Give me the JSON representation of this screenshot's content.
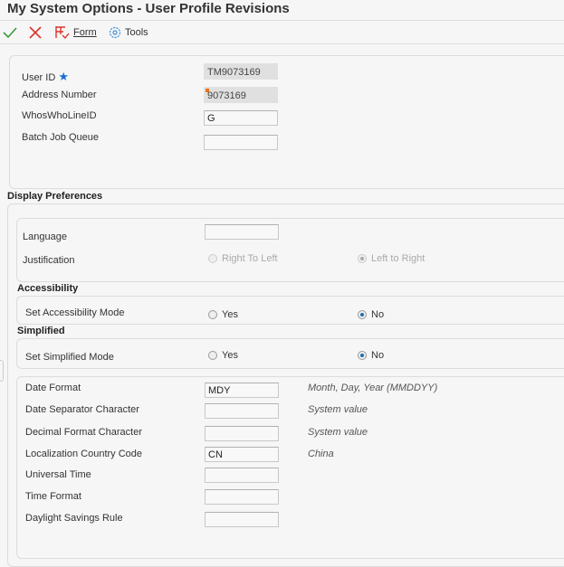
{
  "header": {
    "title": "My System Options - User Profile Revisions"
  },
  "toolbar": {
    "ok_icon": "checkmark-icon",
    "cancel_icon": "x-icon",
    "form_label": "Form",
    "tools_label": "Tools"
  },
  "general": {
    "user_id_label": "User ID",
    "user_id_value": "TM9073169",
    "address_number_label": "Address Number",
    "address_number_value": "9073169",
    "whoswho_label": "WhosWhoLineID",
    "whoswho_value": "G",
    "batch_queue_label": "Batch Job Queue",
    "batch_queue_value": ""
  },
  "display_preferences": {
    "title": "Display Preferences",
    "language_label": "Language",
    "language_value": "",
    "justification_label": "Justification",
    "justification_options": [
      "Right To Left",
      "Left to Right"
    ],
    "justification_selected": "Left to Right"
  },
  "accessibility": {
    "title": "Accessibility",
    "mode_label": "Set Accessibility Mode",
    "options": [
      "Yes",
      "No"
    ],
    "selected": "No"
  },
  "simplified": {
    "title": "Simplified",
    "mode_label": "Set Simplified Mode",
    "options": [
      "Yes",
      "No"
    ],
    "selected": "No"
  },
  "formats": [
    {
      "label": "Date Format",
      "value": "MDY",
      "desc": "Month, Day, Year (MMDDYY)"
    },
    {
      "label": "Date Separator Character",
      "value": "",
      "desc": "System value"
    },
    {
      "label": "Decimal Format Character",
      "value": "",
      "desc": "System value"
    },
    {
      "label": "Localization Country Code",
      "value": "CN",
      "desc": "China"
    },
    {
      "label": "Universal Time",
      "value": "",
      "desc": ""
    },
    {
      "label": "Time Format",
      "value": "",
      "desc": ""
    },
    {
      "label": "Daylight Savings Rule",
      "value": "",
      "desc": ""
    }
  ]
}
